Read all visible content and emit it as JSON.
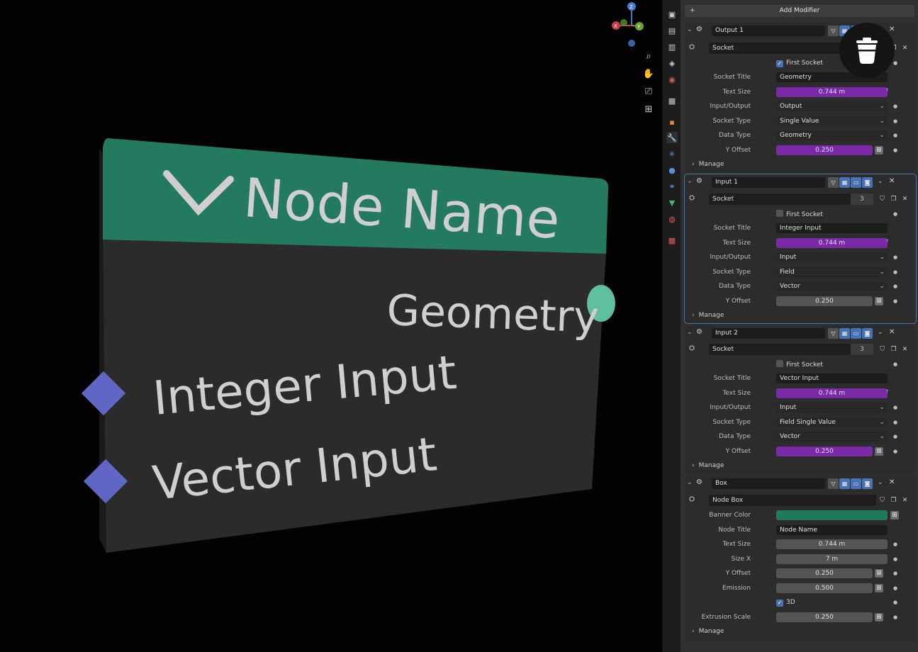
{
  "viewport": {
    "node": {
      "title": "Node Name",
      "output_label": "Geometry",
      "inputs": [
        "Integer Input",
        "Vector Input"
      ],
      "banner_color": "#237a5e",
      "body_color": "#2b2b2b",
      "output_socket_color": "#5fbf9e",
      "input_socket_color": "#6066c4"
    },
    "gizmo": {
      "x": "X",
      "y": "Y",
      "z": "Z"
    }
  },
  "panel": {
    "add_modifier": "Add Modifier",
    "modifiers": [
      {
        "name": "Output 1",
        "sub_name": "Socket",
        "checkbox": {
          "label": "First Socket",
          "checked": true
        },
        "props": [
          {
            "label": "Socket Title",
            "value": "Geometry",
            "kind": "text"
          },
          {
            "label": "Text Size",
            "value": "0.744 m",
            "kind": "purple"
          },
          {
            "label": "Input/Output",
            "value": "Output",
            "kind": "menu"
          },
          {
            "label": "Socket Type",
            "value": "Single Value",
            "kind": "menu"
          },
          {
            "label": "Data Type",
            "value": "Geometry",
            "kind": "menu"
          },
          {
            "label": "Y Offset",
            "value": "0.250",
            "kind": "purple"
          }
        ],
        "manage": "Manage"
      },
      {
        "name": "Input 1",
        "sub_name": "Socket",
        "users": "3",
        "checkbox": {
          "label": "First Socket",
          "checked": false
        },
        "props": [
          {
            "label": "Socket Title",
            "value": "Integer Input",
            "kind": "text"
          },
          {
            "label": "Text Size",
            "value": "0.744 m",
            "kind": "purple"
          },
          {
            "label": "Input/Output",
            "value": "Input",
            "kind": "menu"
          },
          {
            "label": "Socket Type",
            "value": "Field",
            "kind": "menu"
          },
          {
            "label": "Data Type",
            "value": "Vector",
            "kind": "menu"
          },
          {
            "label": "Y Offset",
            "value": "0.250",
            "kind": "num"
          }
        ],
        "manage": "Manage"
      },
      {
        "name": "Input 2",
        "sub_name": "Socket",
        "users": "3",
        "checkbox": {
          "label": "First Socket",
          "checked": false
        },
        "props": [
          {
            "label": "Socket Title",
            "value": "Vector Input",
            "kind": "text"
          },
          {
            "label": "Text Size",
            "value": "0.744 m",
            "kind": "purple"
          },
          {
            "label": "Input/Output",
            "value": "Input",
            "kind": "menu"
          },
          {
            "label": "Socket Type",
            "value": "Field Single Value",
            "kind": "menu"
          },
          {
            "label": "Data Type",
            "value": "Vector",
            "kind": "menu"
          },
          {
            "label": "Y Offset",
            "value": "0.250",
            "kind": "purple"
          }
        ],
        "manage": "Manage"
      },
      {
        "name": "Box",
        "sub_name": "Node Box",
        "props": [
          {
            "label": "Banner Color",
            "value": "",
            "kind": "color",
            "color": "#1f7a5c"
          },
          {
            "label": "Node Title",
            "value": "Node Name",
            "kind": "text"
          },
          {
            "label": "Text Size",
            "value": "0.744 m",
            "kind": "num"
          },
          {
            "label": "Size X",
            "value": "7 m",
            "kind": "num"
          },
          {
            "label": "Y Offset",
            "value": "0.250",
            "kind": "num"
          },
          {
            "label": "Emission",
            "value": "0.500",
            "kind": "num"
          }
        ],
        "checkbox": {
          "label": "3D",
          "checked": true
        },
        "extra_prop": {
          "label": "Extrusion Scale",
          "value": "0.250",
          "kind": "num"
        },
        "manage": "Manage"
      }
    ]
  },
  "colors": {
    "accent": "#4772b3",
    "purple_field": "#7b2aa7"
  }
}
